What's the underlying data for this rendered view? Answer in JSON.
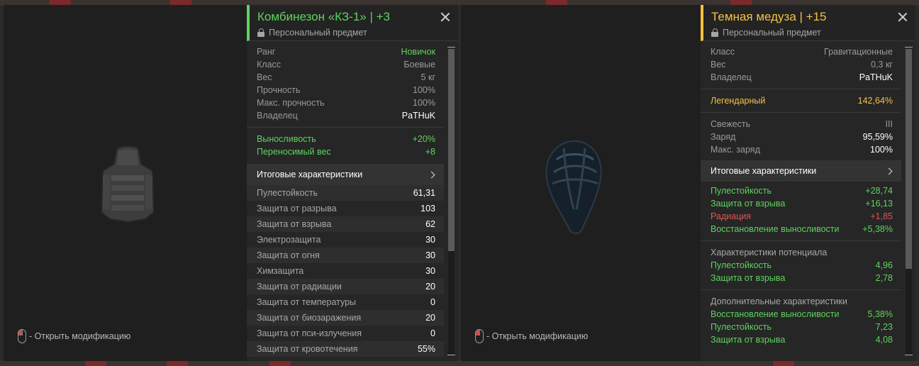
{
  "colors": {
    "green": "#5ed35e",
    "gold": "#f4c142",
    "red": "#e05555"
  },
  "hint": "- Открыть модификацию",
  "left": {
    "title": "Комбинезон «КЗ-1» | +3",
    "subtitle": "Персональный предмет",
    "info": [
      {
        "k": "Ранг",
        "v": "Новичок"
      },
      {
        "k": "Класс",
        "v": "Боевые"
      },
      {
        "k": "Вес",
        "v": "5 кг"
      },
      {
        "k": "Прочность",
        "v": "100%"
      },
      {
        "k": "Макс. прочность",
        "v": "100%"
      },
      {
        "k": "Владелец",
        "v": "PaTHuK"
      }
    ],
    "bonuses": [
      {
        "k": "Выносливость",
        "v": "+20%"
      },
      {
        "k": "Переносимый вес",
        "v": "+8"
      }
    ],
    "section": "Итоговые характеристики",
    "stats": [
      {
        "k": "Пулестойкость",
        "v": "61,31"
      },
      {
        "k": "Защита от разрыва",
        "v": "103"
      },
      {
        "k": "Защита от взрыва",
        "v": "62"
      },
      {
        "k": "Электрозащита",
        "v": "30"
      },
      {
        "k": "Защита от огня",
        "v": "30"
      },
      {
        "k": "Химзащита",
        "v": "30"
      },
      {
        "k": "Защита от радиации",
        "v": "20"
      },
      {
        "k": "Защита от температуры",
        "v": "0"
      },
      {
        "k": "Защита от биозаражения",
        "v": "20"
      },
      {
        "k": "Защита от пси-излучения",
        "v": "0"
      },
      {
        "k": "Защита от кровотечения",
        "v": "55%"
      }
    ]
  },
  "right": {
    "title": "Темная медуза | +15",
    "subtitle": "Персональный предмет",
    "info": [
      {
        "k": "Класс",
        "v": "Гравитационные"
      },
      {
        "k": "Вес",
        "v": "0,3 кг"
      },
      {
        "k": "Владелец",
        "v": "PaTHuK"
      }
    ],
    "legend": {
      "k": "Легендарный",
      "v": "142,64%"
    },
    "info2": [
      {
        "k": "Свежесть",
        "v": "III"
      },
      {
        "k": "Заряд",
        "v": "95,59%"
      },
      {
        "k": "Макс. заряд",
        "v": "100%"
      }
    ],
    "section": "Итоговые характеристики",
    "totals": [
      {
        "k": "Пулестойкость",
        "v": "+28,74"
      },
      {
        "k": "Защита от взрыва",
        "v": "+16,13"
      },
      {
        "k": "Радиация",
        "v": "+1,85"
      },
      {
        "k": "Восстановление выносливости",
        "v": "+5,38%"
      }
    ],
    "potential_title": "Характеристики потенциала",
    "potential": [
      {
        "k": "Пулестойкость",
        "v": "4,96"
      },
      {
        "k": "Защита от взрыва",
        "v": "2,78"
      }
    ],
    "extra_title": "Дополнительные характеристики",
    "extra": [
      {
        "k": "Восстановление выносливости",
        "v": "5,38%"
      },
      {
        "k": "Пулестойкость",
        "v": "7,23"
      },
      {
        "k": "Защита от взрыва",
        "v": "4,08"
      }
    ]
  }
}
